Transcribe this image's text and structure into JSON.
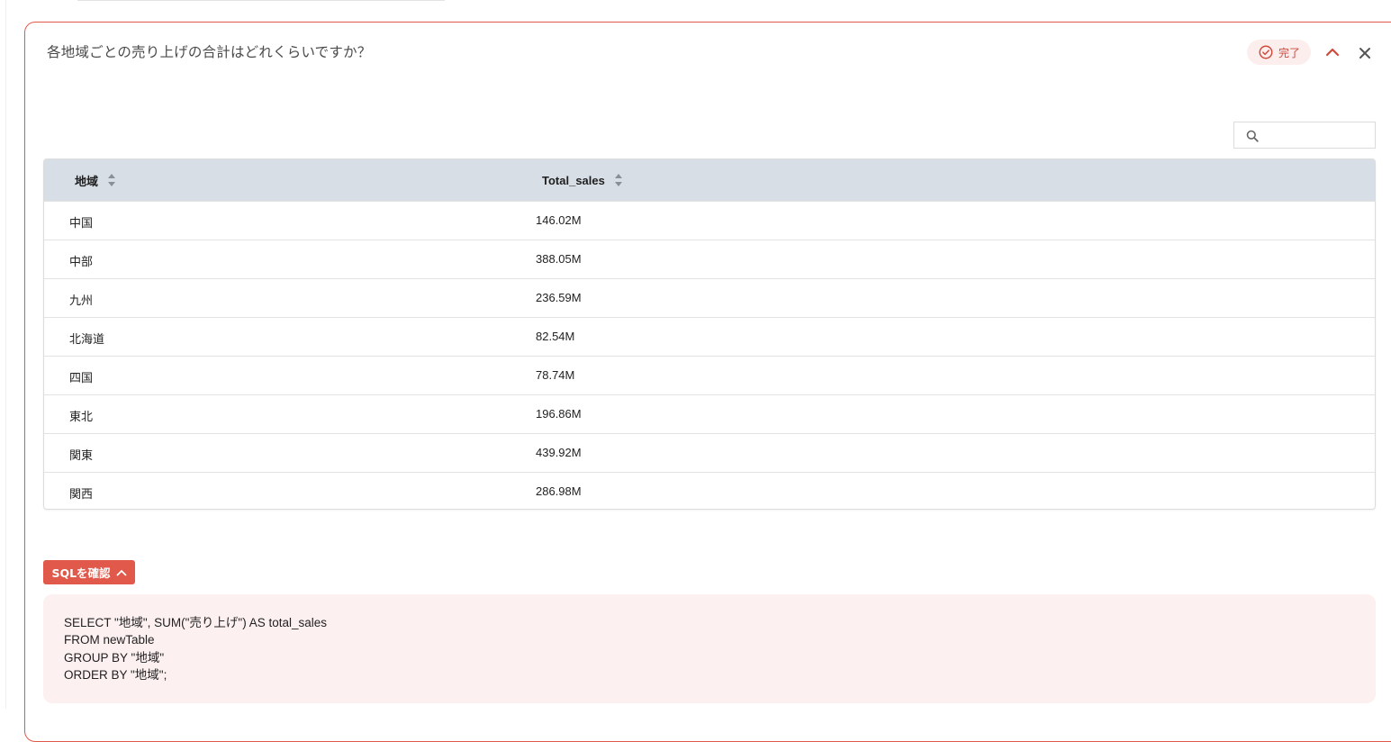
{
  "question": "各地域ごとの売り上げの合計はどれくらいですか？",
  "status": {
    "label": "完了",
    "icon": "check-circle-icon"
  },
  "icons": {
    "collapse": "chevron-up-icon",
    "close": "close-icon",
    "search": "search-icon",
    "sort": "sort-icon"
  },
  "search": {
    "placeholder": "",
    "value": ""
  },
  "table": {
    "headers": [
      "地域",
      "Total_sales"
    ],
    "rows": [
      [
        "中国",
        "146.02M"
      ],
      [
        "中部",
        "388.05M"
      ],
      [
        "九州",
        "236.59M"
      ],
      [
        "北海道",
        "82.54M"
      ],
      [
        "四国",
        "78.74M"
      ],
      [
        "東北",
        "196.86M"
      ],
      [
        "関東",
        "439.92M"
      ],
      [
        "関西",
        "286.98M"
      ]
    ]
  },
  "sql": {
    "toggle_label": "SQLを確認",
    "lines": [
      "SELECT \"地域\", SUM(\"売り上げ\") AS total_sales",
      "FROM newTable",
      "GROUP BY \"地域\"",
      "ORDER BY \"地域\";"
    ]
  },
  "colors": {
    "accent": "#e0594a",
    "header_bg": "#d7dee6",
    "sql_bg": "#fdf0f0",
    "badge_bg": "#fdeeee"
  }
}
